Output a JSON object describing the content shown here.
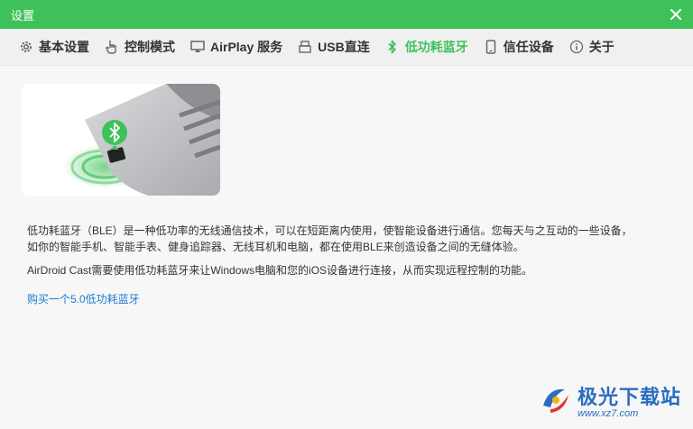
{
  "window": {
    "title": "设置"
  },
  "tabs": [
    {
      "label": "基本设置",
      "icon": "gear-icon"
    },
    {
      "label": "控制模式",
      "icon": "hand-pointer-icon"
    },
    {
      "label": "AirPlay 服务",
      "icon": "airplay-icon"
    },
    {
      "label": "USB直连",
      "icon": "usb-icon"
    },
    {
      "label": "低功耗蓝牙",
      "icon": "bluetooth-icon",
      "active": true
    },
    {
      "label": "信任设备",
      "icon": "phone-icon"
    },
    {
      "label": "关于",
      "icon": "info-icon"
    }
  ],
  "content": {
    "description_line1": "低功耗蓝牙（BLE）是一种低功率的无线通信技术，可以在短距离内使用，使智能设备进行通信。您每天与之互动的一些设备，",
    "description_line2": "如你的智能手机、智能手表、健身追踪器、无线耳机和电脑，都在使用BLE来创造设备之间的无缝体验。",
    "description_2": "AirDroid Cast需要使用低功耗蓝牙来让Windows电脑和您的iOS设备进行连接，从而实现远程控制的功能。",
    "buy_link": "购买一个5.0低功耗蓝牙"
  },
  "watermark": {
    "main": "极光下载站",
    "sub": "www.xz7.com"
  },
  "colors": {
    "accent": "#3fc15a",
    "link": "#1f7acf",
    "watermark": "#2a6cc0"
  }
}
